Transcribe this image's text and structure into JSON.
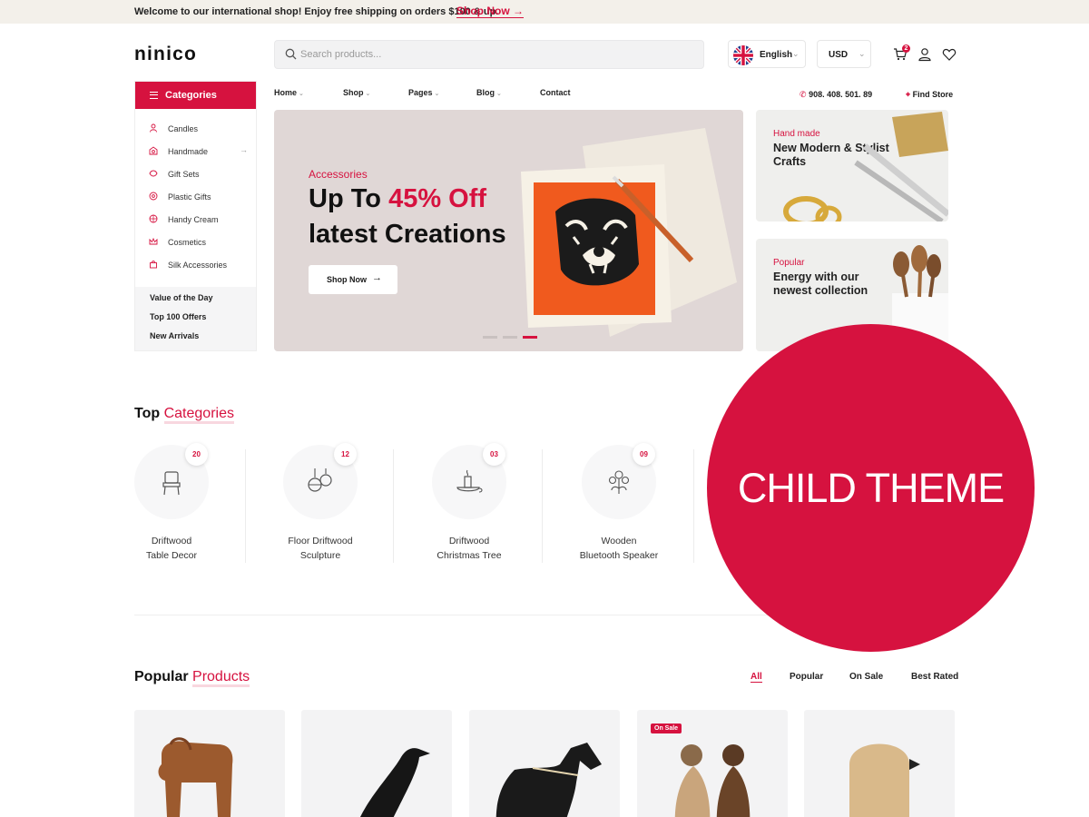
{
  "topbar": {
    "message": "Welcome to our international shop! Enjoy free shipping on orders $100 & up.",
    "link": "Shop Now"
  },
  "header": {
    "logo": "ninico",
    "search_placeholder": "Search products...",
    "language": "English",
    "currency": "USD",
    "cart_count": "2"
  },
  "categories": {
    "title": "Categories",
    "items": [
      {
        "label": "Candles",
        "icon": "candle-icon"
      },
      {
        "label": "Handmade",
        "icon": "handmade-icon",
        "has_submenu": true
      },
      {
        "label": "Gift Sets",
        "icon": "gift-icon"
      },
      {
        "label": "Plastic Gifts",
        "icon": "plastic-gift-icon"
      },
      {
        "label": "Handy Cream",
        "icon": "cream-icon"
      },
      {
        "label": "Cosmetics",
        "icon": "crown-icon"
      },
      {
        "label": "Silk Accessories",
        "icon": "bag-icon"
      }
    ],
    "extra": [
      "Value of the Day",
      "Top 100 Offers",
      "New Arrivals"
    ]
  },
  "nav": {
    "items": [
      "Home",
      "Shop",
      "Pages",
      "Blog",
      "Contact"
    ],
    "phone": "908. 408. 501. 89",
    "find_store": "Find Store"
  },
  "hero": {
    "category": "Accessories",
    "title_prefix": "Up To ",
    "title_highlight": "45% Off",
    "title_line2": "latest Creations",
    "button": "Shop Now",
    "active_slide": 3
  },
  "side_banners": [
    {
      "sub": "Hand made",
      "title": "New Modern & Stylist Crafts"
    },
    {
      "sub": "Popular",
      "title": "Energy with our newest collection"
    }
  ],
  "top_categories": {
    "title_main": "Top",
    "title_accent": "Categories",
    "items": [
      {
        "count": "20",
        "line1": "Driftwood",
        "line2": "Table Decor",
        "icon": "chair-icon"
      },
      {
        "count": "12",
        "line1": "Floor Driftwood",
        "line2": "Sculpture",
        "icon": "ornament-icon"
      },
      {
        "count": "03",
        "line1": "Driftwood",
        "line2": "Christmas Tree",
        "icon": "candle-holder-icon"
      },
      {
        "count": "09",
        "line1": "Wooden",
        "line2": "Bluetooth Speaker",
        "icon": "flower-icon"
      }
    ]
  },
  "popular": {
    "title_main": "Popular",
    "title_accent": "Products",
    "tabs": [
      "All",
      "Popular",
      "On Sale",
      "Best Rated"
    ],
    "active_tab": "All",
    "on_sale_label": "On Sale"
  },
  "overlay": {
    "text": "CHILD THEME"
  },
  "colors": {
    "accent": "#d6123f",
    "topbar_bg": "#f3f0ea",
    "hero_bg": "#e0d7d6"
  }
}
